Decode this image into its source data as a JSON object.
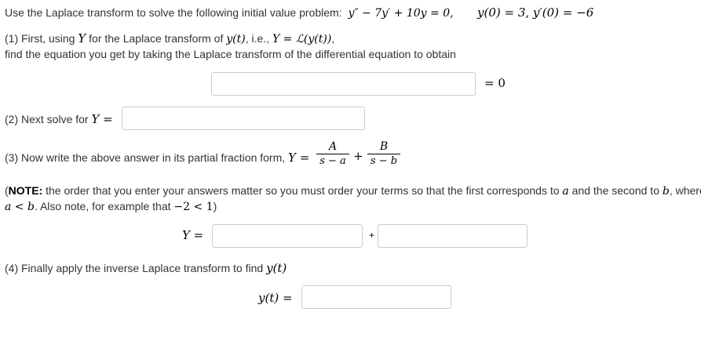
{
  "problem": {
    "intro": "Use the Laplace transform to solve the following initial value problem:",
    "ode": "y″ − 7y′ + 10y = 0,",
    "initial": "y(0) = 3, y′(0) = −6"
  },
  "step1": {
    "line1_a": "(1) First, using",
    "line1_Y": "Y",
    "line1_b": "for the Laplace transform of",
    "line1_yt": "y(t)",
    "line1_c": ", i.e.,",
    "line1_def": "Y = ℒ(y(t))",
    "line1_d": ",",
    "line2": "find the equation you get by taking the Laplace transform of the differential equation to obtain",
    "eq_suffix": "= 0",
    "input_value": ""
  },
  "step2": {
    "label": "(2) Next solve for",
    "label_math": "Y =",
    "input_value": ""
  },
  "step3": {
    "label": "(3) Now write the above answer in its partial fraction form,",
    "label_math": "Y =",
    "frac1_num": "A",
    "frac1_den": "s − a",
    "plus": "+",
    "frac2_num": "B",
    "frac2_den": "s − b"
  },
  "note": {
    "open": "(",
    "bold": "NOTE:",
    "text1": " the order that you enter your answers matter so you must order your terms so that the first corresponds to ",
    "a": "a",
    "text2": " and the second to ",
    "b": "b",
    "text3": ", where",
    "cond": "a < b",
    "text4": ". Also note, for example that ",
    "example": "−2 < 1",
    "close": ")"
  },
  "answer_Y": {
    "label": "Y =",
    "plus": "+",
    "input1_value": "",
    "input2_value": ""
  },
  "step4": {
    "label": "(4) Finally apply the inverse Laplace transform to find",
    "label_math": "y(t)",
    "answer_label": "y(t) =",
    "input_value": ""
  }
}
